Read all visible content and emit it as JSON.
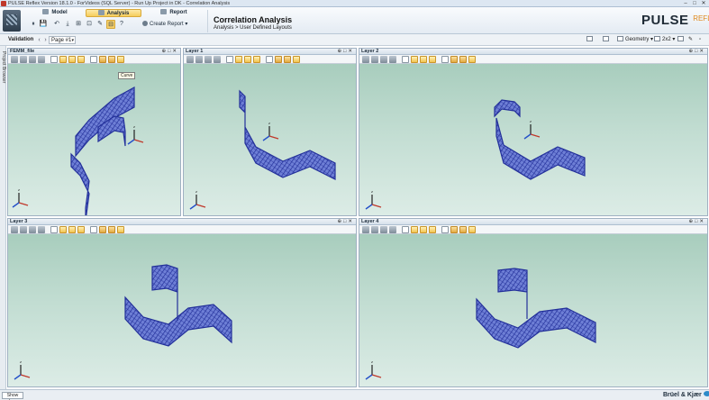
{
  "window": {
    "title": "PULSE Reflex Version 18.1.0 - ForVideos (SQL Server) - Run Up Project in DK - Correlation Analysis",
    "controls": {
      "minimize": "–",
      "maximize": "□",
      "close": "✕"
    }
  },
  "ribbon": {
    "tabs": [
      {
        "label": "Model",
        "active": false
      },
      {
        "label": "Analysis",
        "active": true
      },
      {
        "label": "Report",
        "active": false
      }
    ],
    "quick_access": [
      "⏸",
      "💾",
      "↶",
      "⤓",
      "⊞",
      "⊡",
      "✎",
      "⊟",
      "?"
    ],
    "create_report": "Create Report",
    "context_title": "Correlation Analysis",
    "context_breadcrumb": "Analysis > User Defined Layouts",
    "brand": "PULSE",
    "brand_suffix": "REFLEX"
  },
  "toolstrip": {
    "label": "Validation",
    "page": "Page #1",
    "geometry": "Geometry",
    "layout": "2x2"
  },
  "side_panel": {
    "label": "Project Browser"
  },
  "tooltip": "Curve",
  "panes": [
    {
      "title": "FEMM_file"
    },
    {
      "title": "Layer 1"
    },
    {
      "title": "Layer 2"
    },
    {
      "title": "Layer 3"
    },
    {
      "title": "Layer 4"
    }
  ],
  "axis_labels": {
    "x": "x",
    "y": "y",
    "z": "z"
  },
  "colors": {
    "mesh": "#23309a",
    "mesh_light": "#6e7fd6",
    "viewport_top": "#a8cdbd",
    "viewport_bottom": "#dcece6",
    "ribbon_highlight": "#f6cd5a"
  },
  "statusbar": {
    "show_log": "Show Log",
    "company": "Brüel & Kjær"
  }
}
